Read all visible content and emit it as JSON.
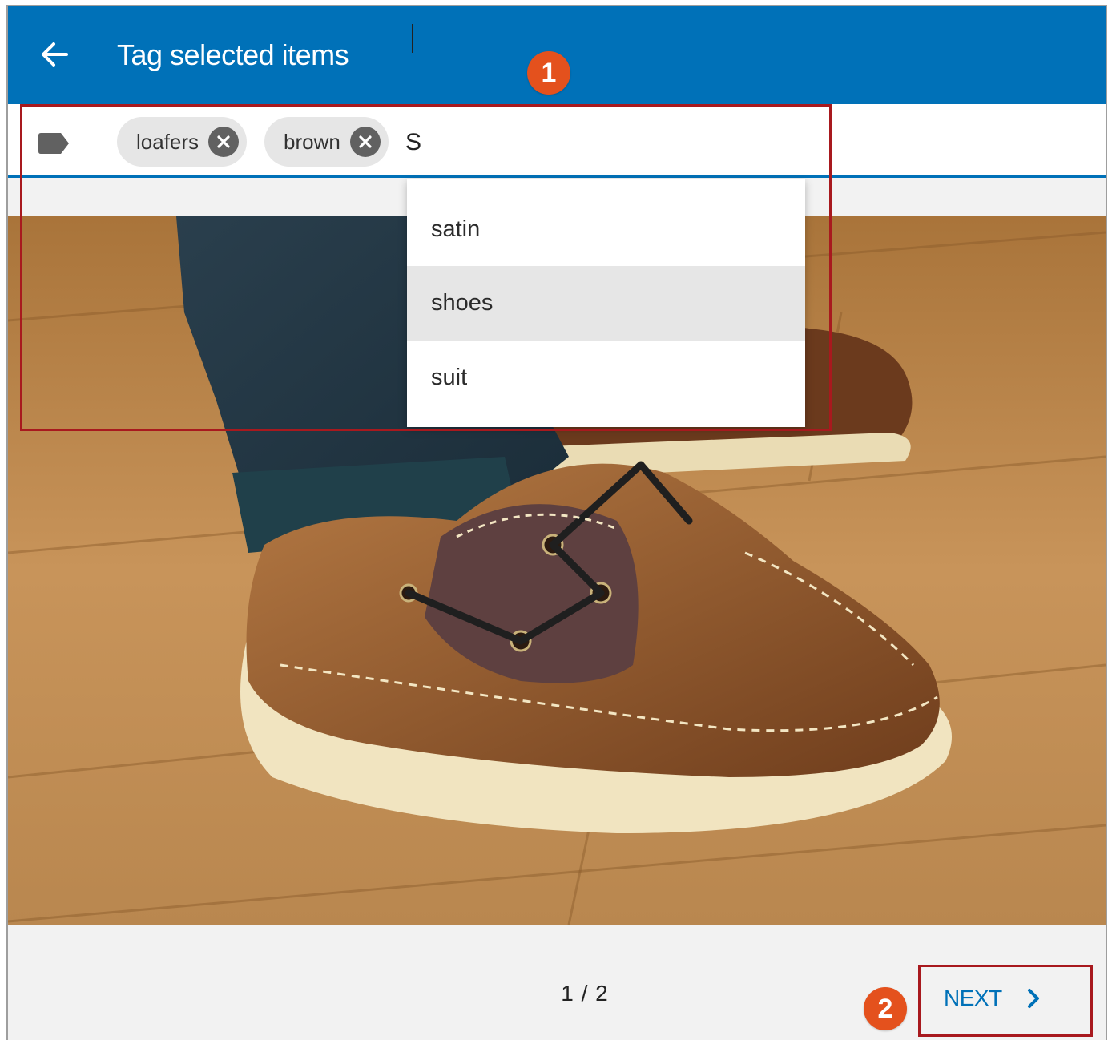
{
  "appbar": {
    "title": "Tag selected items",
    "back_icon": "arrow-left-icon",
    "color": "#0071b8"
  },
  "tags": {
    "icon": "label-icon",
    "chips": [
      {
        "label": "loafers",
        "remove_icon": "close-circle-icon"
      },
      {
        "label": "brown",
        "remove_icon": "close-circle-icon"
      }
    ],
    "input_value": "S"
  },
  "suggestions": {
    "items": [
      "satin",
      "shoes",
      "suit"
    ],
    "highlighted": "shoes"
  },
  "footer": {
    "page_indicator": "1 / 2",
    "next_label": "NEXT",
    "next_icon": "chevron-right-icon"
  },
  "annotations": {
    "badge_1": "1",
    "badge_2": "2",
    "badge_color": "#e4511d",
    "box_color": "#a8191e"
  },
  "image": {
    "subject": "brown-boat-shoe-photo"
  }
}
